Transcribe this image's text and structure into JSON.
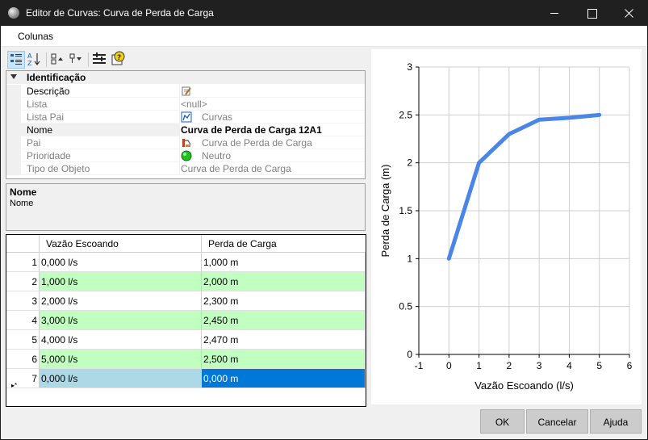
{
  "window": {
    "title": "Editor de Curvas: Curva de Perda de Carga"
  },
  "menu": {
    "items": [
      "Colunas"
    ]
  },
  "toolbar": {
    "icons": [
      "categorized-icon",
      "alphabetical-sort-icon",
      "expand-icon",
      "collapse-icon",
      "properties-icon",
      "help-icon"
    ]
  },
  "property_grid": {
    "category": "Identificação",
    "rows": [
      {
        "name": "Descrição",
        "value": "",
        "icon": "edit-icon"
      },
      {
        "name": "Lista",
        "value": "<null>"
      },
      {
        "name": "Lista Pai",
        "value": "Curvas",
        "icon": "curves-icon"
      },
      {
        "name": "Nome",
        "value": "Curva de Perda de Carga 12A1"
      },
      {
        "name": "Pai",
        "value": "Curva de Perda de Carga",
        "icon": "curve-type-icon"
      },
      {
        "name": "Prioridade",
        "value": "Neutro",
        "icon": "green-circle-icon"
      },
      {
        "name": "Tipo de Objeto",
        "value": "Curva de Perda de Carga"
      }
    ]
  },
  "description_panel": {
    "title": "Nome",
    "text": "Nome"
  },
  "table": {
    "columns": [
      "Vazão Escoando",
      "Perda de Carga"
    ],
    "rows": [
      {
        "index": "1",
        "flow": "0,000 l/s",
        "loss": "1,000 m"
      },
      {
        "index": "2",
        "flow": "1,000 l/s",
        "loss": "2,000 m"
      },
      {
        "index": "3",
        "flow": "2,000 l/s",
        "loss": "2,300 m"
      },
      {
        "index": "4",
        "flow": "3,000 l/s",
        "loss": "2,450 m"
      },
      {
        "index": "5",
        "flow": "4,000 l/s",
        "loss": "2,470 m"
      },
      {
        "index": "6",
        "flow": "5,000 l/s",
        "loss": "2,500 m"
      },
      {
        "index": "7",
        "flow": "0,000 l/s",
        "loss": "0,000 m"
      }
    ],
    "row_indicator": "▸*"
  },
  "chart_data": {
    "type": "line",
    "x": [
      0,
      1,
      2,
      3,
      4,
      5
    ],
    "series": [
      {
        "values": [
          1,
          2,
          2.3,
          2.45,
          2.47,
          2.5
        ],
        "color": "#4a86e8"
      }
    ],
    "xlabel": "Vazão Escoando (l/s)",
    "ylabel": "Perda de Carga (m)",
    "xlim": [
      -1,
      6
    ],
    "ylim": [
      0,
      3
    ],
    "xticks": [
      -1,
      0,
      1,
      2,
      3,
      4,
      5,
      6
    ],
    "yticks": [
      0,
      0.5,
      1,
      1.5,
      2,
      2.5,
      3
    ],
    "xtick_labels": [
      "-1",
      "0",
      "1",
      "2",
      "3",
      "4",
      "5",
      "6"
    ],
    "ytick_labels": [
      "0",
      "0.5",
      "1",
      "1.5",
      "2",
      "2.5",
      "3"
    ],
    "grid": true
  },
  "buttons": {
    "ok": "OK",
    "cancel": "Cancelar",
    "help": "Ajuda"
  }
}
